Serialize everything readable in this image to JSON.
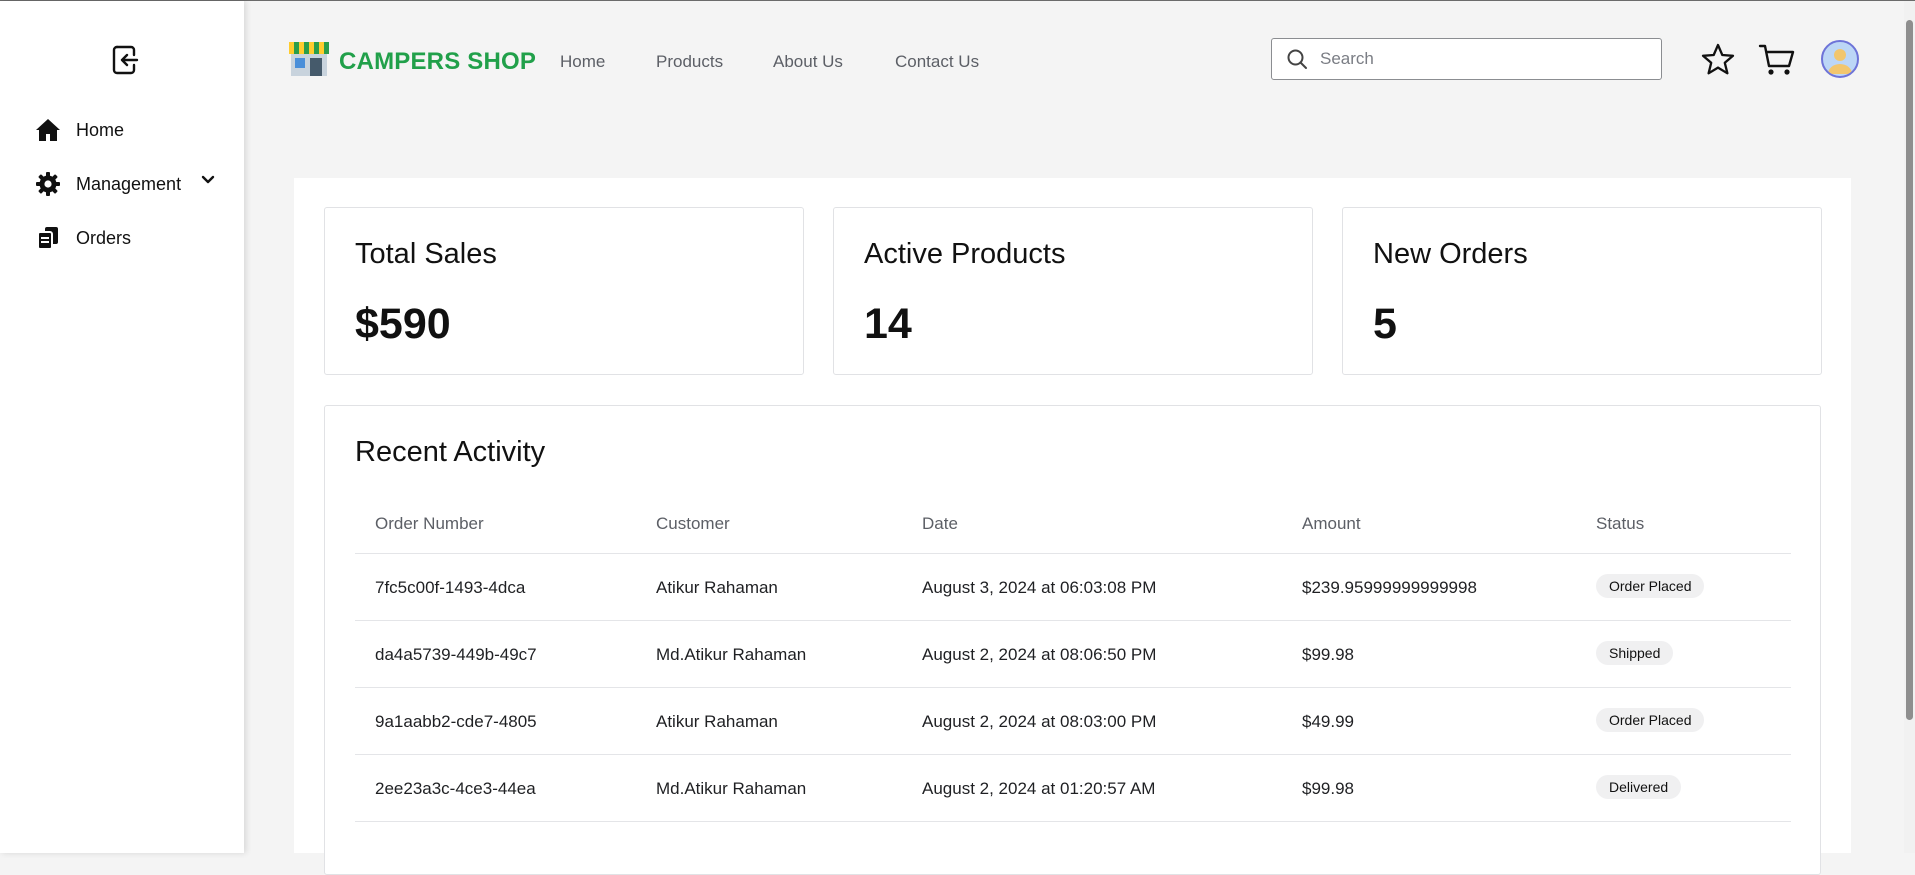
{
  "sidebar": {
    "logout_icon": "logout-icon",
    "items": [
      {
        "label": "Home",
        "icon": "home-icon"
      },
      {
        "label": "Management",
        "icon": "gear-icon"
      },
      {
        "label": "Orders",
        "icon": "orders-icon"
      }
    ]
  },
  "header": {
    "brand": "CAMPERS SHOP",
    "nav": [
      "Home",
      "Products",
      "About Us",
      "Contact Us"
    ],
    "search_placeholder": "Search",
    "icons": [
      "star-icon",
      "cart-icon",
      "avatar"
    ]
  },
  "colors": {
    "brand_green": "#21a04a",
    "avatar_border": "#6d73d8"
  },
  "stats": [
    {
      "title": "Total Sales",
      "value": "$590"
    },
    {
      "title": "Active Products",
      "value": "14"
    },
    {
      "title": "New Orders",
      "value": "5"
    }
  ],
  "recent_activity": {
    "title": "Recent Activity",
    "columns": [
      "Order Number",
      "Customer",
      "Date",
      "Amount",
      "Status"
    ],
    "rows": [
      {
        "order": "7fc5c00f-1493-4dca",
        "customer": "Atikur Rahaman",
        "date": "August 3, 2024 at 06:03:08 PM",
        "amount": "$239.95999999999998",
        "status": "Order Placed"
      },
      {
        "order": "da4a5739-449b-49c7",
        "customer": "Md.Atikur Rahaman",
        "date": "August 2, 2024 at 08:06:50 PM",
        "amount": "$99.98",
        "status": "Shipped"
      },
      {
        "order": "9a1aabb2-cde7-4805",
        "customer": "Atikur Rahaman",
        "date": "August 2, 2024 at 08:03:00 PM",
        "amount": "$49.99",
        "status": "Order Placed"
      },
      {
        "order": "2ee23a3c-4ce3-44ea",
        "customer": "Md.Atikur Rahaman",
        "date": "August 2, 2024 at 01:20:57 AM",
        "amount": "$99.98",
        "status": "Delivered"
      }
    ]
  }
}
